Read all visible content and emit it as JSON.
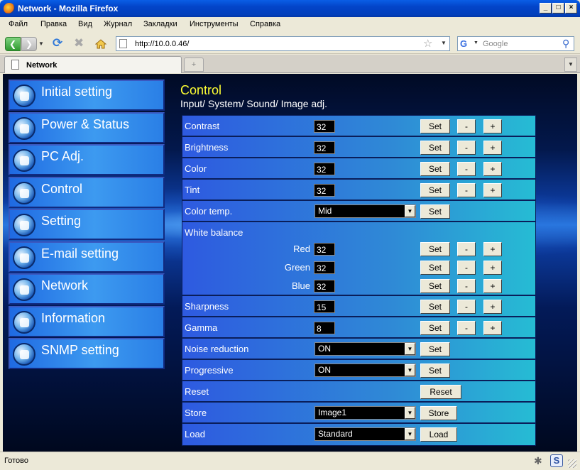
{
  "window": {
    "title": "Network - Mozilla Firefox"
  },
  "menubar": {
    "items": [
      "Файл",
      "Правка",
      "Вид",
      "Журнал",
      "Закладки",
      "Инструменты",
      "Справка"
    ]
  },
  "toolbar": {
    "url": "http://10.0.0.46/",
    "search_placeholder": "Google"
  },
  "tabs": [
    {
      "label": "Network"
    }
  ],
  "sidebar": {
    "items": [
      {
        "label": "Initial setting",
        "icon": "gear-icon"
      },
      {
        "label": "Power & Status",
        "icon": "power-icon"
      },
      {
        "label": "PC Adj.",
        "icon": "monitor-icon"
      },
      {
        "label": "Control",
        "icon": "dpad-icon"
      },
      {
        "label": "Setting",
        "icon": "wrench-icon"
      },
      {
        "label": "E-mail setting",
        "icon": "envelope-icon"
      },
      {
        "label": "Network",
        "icon": "network-icon"
      },
      {
        "label": "Information",
        "icon": "info-icon"
      },
      {
        "label": "SNMP setting",
        "icon": "snmp-icon"
      }
    ]
  },
  "main": {
    "title": "Control",
    "subtitle": "Input/ System/ Sound/ Image adj.",
    "rows": {
      "contrast": {
        "label": "Contrast",
        "value": "32"
      },
      "brightness": {
        "label": "Brightness",
        "value": "32"
      },
      "color": {
        "label": "Color",
        "value": "32"
      },
      "tint": {
        "label": "Tint",
        "value": "32"
      },
      "color_temp": {
        "label": "Color temp.",
        "value": "Mid"
      },
      "white_balance": {
        "label": "White balance",
        "red": {
          "label": "Red",
          "value": "32"
        },
        "green": {
          "label": "Green",
          "value": "32"
        },
        "blue": {
          "label": "Blue",
          "value": "32"
        }
      },
      "sharpness": {
        "label": "Sharpness",
        "value": "15"
      },
      "gamma": {
        "label": "Gamma",
        "value": "8"
      },
      "noise_reduction": {
        "label": "Noise reduction",
        "value": "ON"
      },
      "progressive": {
        "label": "Progressive",
        "value": "ON"
      },
      "reset": {
        "label": "Reset"
      },
      "store": {
        "label": "Store",
        "value": "Image1"
      },
      "load": {
        "label": "Load",
        "value": "Standard"
      }
    },
    "buttons": {
      "set": "Set",
      "minus": "-",
      "plus": "+",
      "reset": "Reset",
      "store": "Store",
      "load": "Load"
    }
  },
  "status": {
    "text": "Готово"
  }
}
